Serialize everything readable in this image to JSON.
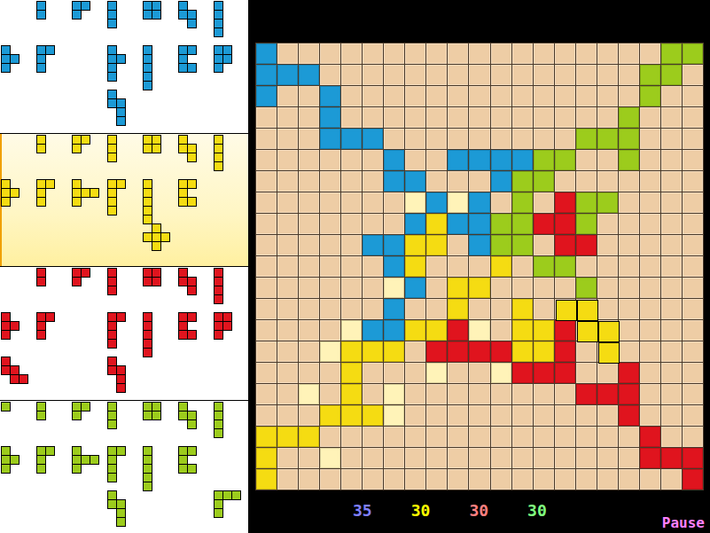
{
  "players": [
    {
      "mark": "B",
      "color": "#1c9ad6",
      "score": "35",
      "score_color": "#8080ff",
      "selected": false,
      "tray": [
        [
          null,
          [
            "#",
            "#"
          ],
          [
            "##",
            "#."
          ],
          [
            "#",
            "#",
            "#"
          ],
          [
            "##",
            "##"
          ],
          [
            "#.",
            "##",
            ".#"
          ],
          [
            "#",
            "#",
            "#",
            "#"
          ]
        ],
        [
          [
            "#.",
            "##",
            "#."
          ],
          [
            "##",
            "#.",
            "#."
          ],
          null,
          [
            "#.",
            "##",
            "#.",
            "#."
          ],
          [
            "#",
            "#",
            "#",
            "#",
            "#"
          ],
          [
            "##",
            "#.",
            "##"
          ],
          [
            "##",
            "##",
            "#."
          ]
        ],
        [
          null,
          null,
          null,
          [
            "#.",
            "##",
            ".#",
            ".#"
          ],
          null,
          null,
          null
        ]
      ]
    },
    {
      "mark": "Y",
      "color": "#f5dc12",
      "score": "30",
      "score_color": "#ffff00",
      "selected": true,
      "tray": [
        [
          null,
          [
            "#",
            "#"
          ],
          [
            "##",
            "#."
          ],
          [
            "#",
            "#",
            "#"
          ],
          [
            "##",
            "##"
          ],
          [
            "#.",
            "##",
            ".#"
          ],
          [
            "#",
            "#",
            "#",
            "#"
          ]
        ],
        [
          [
            "#.",
            "##",
            "#."
          ],
          [
            "##",
            "#.",
            "#."
          ],
          [
            "#..",
            "###",
            "#.."
          ],
          [
            "##",
            "#.",
            "#.",
            "#."
          ],
          [
            "#",
            "#",
            "#",
            "#",
            "#"
          ],
          [
            "##",
            "#.",
            "##"
          ],
          null
        ],
        [
          null,
          null,
          null,
          null,
          [
            ".#.",
            "###",
            ".#."
          ],
          null,
          null
        ]
      ]
    },
    {
      "mark": "R",
      "color": "#e0141e",
      "score": "30",
      "score_color": "#ff8080",
      "selected": false,
      "tray": [
        [
          null,
          [
            "#",
            "#"
          ],
          [
            "##",
            "#."
          ],
          [
            "#",
            "#",
            "#"
          ],
          [
            "##",
            "##"
          ],
          [
            "#.",
            "##",
            ".#"
          ],
          [
            "#",
            "#",
            "#",
            "#"
          ]
        ],
        [
          [
            "#.",
            "##",
            "#."
          ],
          [
            "##",
            "#.",
            "#."
          ],
          null,
          [
            "##",
            "#.",
            "#.",
            "#."
          ],
          [
            "#",
            "#",
            "#",
            "#",
            "#"
          ],
          [
            "##",
            "#.",
            "##"
          ],
          [
            "##",
            "##",
            "#."
          ]
        ],
        [
          [
            "#..",
            "##.",
            ".##"
          ],
          null,
          null,
          [
            "#.",
            "##",
            ".#",
            ".#"
          ],
          null,
          null,
          null
        ]
      ]
    },
    {
      "mark": "G",
      "color": "#9ccc1c",
      "score": "30",
      "score_color": "#80ff80",
      "selected": false,
      "tray": [
        [
          [
            "#"
          ],
          [
            "#",
            "#"
          ],
          [
            "##",
            "#."
          ],
          [
            "#",
            "#",
            "#"
          ],
          [
            "##",
            "##"
          ],
          [
            "#.",
            "##",
            ".#"
          ],
          [
            "#",
            "#",
            "#",
            "#"
          ]
        ],
        [
          [
            "#.",
            "##",
            "#."
          ],
          [
            "##",
            "#.",
            "#."
          ],
          [
            "#..",
            "###",
            "#.."
          ],
          [
            "##",
            "#.",
            "#.",
            "#."
          ],
          [
            "#",
            "#",
            "#",
            "#",
            "#"
          ],
          [
            "##",
            "#.",
            "##"
          ],
          null
        ],
        [
          null,
          null,
          null,
          [
            "#.",
            "##",
            ".#",
            ".#"
          ],
          null,
          null,
          [
            "###",
            "#..",
            "#.."
          ]
        ]
      ]
    }
  ],
  "board": {
    "empty": ".",
    "hint": "h",
    "hint_color": "#fff3b8",
    "rows": [
      "B..................GG",
      "BBB...............GG.",
      "B..B..............G..",
      "...B.............G...",
      "...BBB.........GGG...",
      "......B..BBBBGG..G...",
      "......BB...BGG.......",
      ".......hBhB.G.RGG....",
      ".......BYBBGGRRG.....",
      ".....BBYY.BGG.RR.....",
      "......BY...Y.GG......",
      "......hB.YY....G.....",
      "......B..Y..Y........",
      "....hBBYYRh.YYR......",
      "...hYYY.RRRRYYR......",
      "....Y...h..hRRR..R...",
      "..h.Y.h........RRR...",
      "...YYYh..........R...",
      "YYY...............R..",
      "Y..h..............RRR",
      "Y...................R"
    ]
  },
  "dragging": {
    "mark": "Y",
    "shape": [
      "##.",
      ".##",
      "..#"
    ]
  },
  "pause": "Pause"
}
